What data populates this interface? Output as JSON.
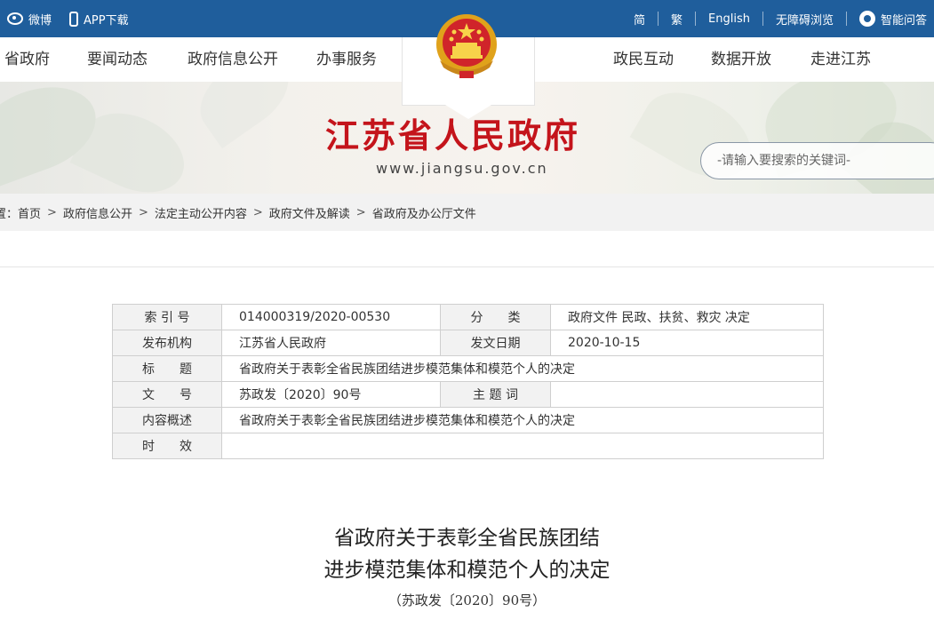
{
  "topbar": {
    "weibo": "微博",
    "app": "APP下载",
    "simplified": "简",
    "traditional": "繁",
    "english": "English",
    "accessible": "无障碍浏览",
    "assistant": "智能问答"
  },
  "nav": {
    "left": [
      "省政府",
      "要闻动态",
      "政府信息公开",
      "办事服务"
    ],
    "right": [
      "政民互动",
      "数据开放",
      "走进江苏"
    ]
  },
  "banner": {
    "title": "江苏省人民政府",
    "url": "www.jiangsu.gov.cn"
  },
  "search": {
    "placeholder": "-请输入要搜索的关键词-"
  },
  "breadcrumb": {
    "prefix": "置：",
    "items": [
      "首页",
      "政府信息公开",
      "法定主动公开内容",
      "政府文件及解读",
      "省政府及办公厅文件"
    ],
    "sep": ">"
  },
  "info": {
    "index_label": "索 引 号",
    "index_value": "014000319/2020-00530",
    "category_label": "分　　类",
    "category_value": "政府文件 民政、扶贫、救灾 决定",
    "publisher_label": "发布机构",
    "publisher_value": "江苏省人民政府",
    "date_label": "发文日期",
    "date_value": "2020-10-15",
    "title_label": "标　　题",
    "title_value": "省政府关于表彰全省民族团结进步模范集体和模范个人的决定",
    "docno_label": "文　　号",
    "docno_value": "苏政发〔2020〕90号",
    "topic_label": "主 题 词",
    "topic_value": "",
    "summary_label": "内容概述",
    "summary_value": "省政府关于表彰全省民族团结进步模范集体和模范个人的决定",
    "validity_label": "时　　效",
    "validity_value": ""
  },
  "document": {
    "title_line1": "省政府关于表彰全省民族团结",
    "title_line2": "进步模范集体和模范个人的决定",
    "number": "（苏政发〔2020〕90号）"
  },
  "colors": {
    "topbar": "#1f5e9c",
    "title_red": "#c4141b",
    "emblem_gold": "#e0a21b"
  },
  "icons": [
    "weibo-icon",
    "phone-icon",
    "robot-icon",
    "national-emblem-icon"
  ]
}
